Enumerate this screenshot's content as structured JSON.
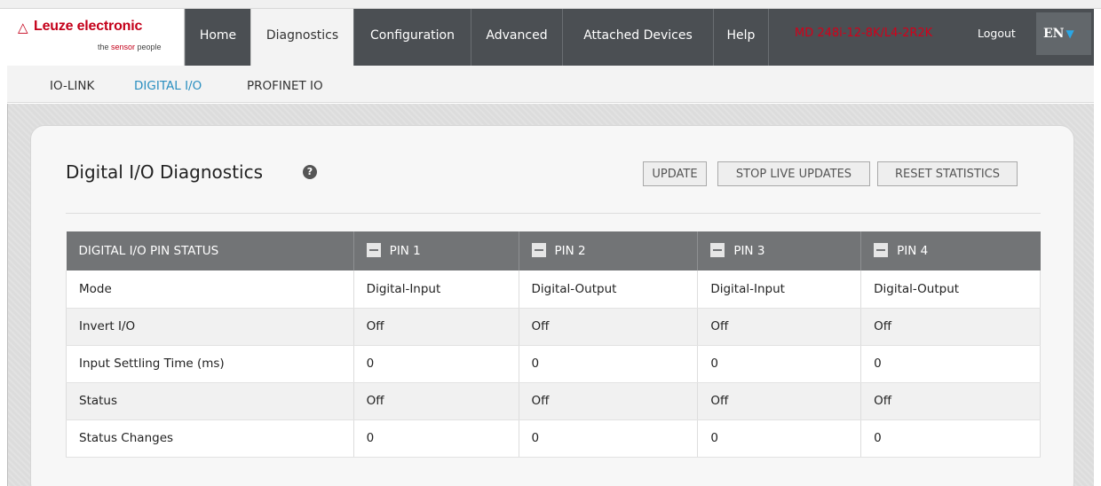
{
  "brand": {
    "name": "Leuze electronic",
    "tagline_prefix": "the ",
    "tagline_accent": "sensor",
    "tagline_suffix": " people"
  },
  "nav": {
    "items": [
      {
        "label": "Home"
      },
      {
        "label": "Diagnostics"
      },
      {
        "label": "Configuration"
      },
      {
        "label": "Advanced"
      },
      {
        "label": "Attached Devices"
      },
      {
        "label": "Help"
      }
    ],
    "device_name": "MD 248i-12-8K/L4-2R2K",
    "logout": "Logout",
    "language": "EN",
    "active_index": 1
  },
  "subnav": {
    "items": [
      {
        "label": "IO-LINK"
      },
      {
        "label": "DIGITAL I/O"
      },
      {
        "label": "PROFINET IO"
      }
    ],
    "active_index": 1
  },
  "page": {
    "title": "Digital I/O Diagnostics",
    "buttons": {
      "update": "UPDATE",
      "stop": "STOP LIVE UPDATES",
      "reset": "RESET STATISTICS"
    }
  },
  "table": {
    "header": "DIGITAL I/O PIN STATUS",
    "pins": [
      "PIN 1",
      "PIN 2",
      "PIN 3",
      "PIN 4"
    ],
    "rows": [
      {
        "label": "Mode",
        "values": [
          "Digital-Input",
          "Digital-Output",
          "Digital-Input",
          "Digital-Output"
        ]
      },
      {
        "label": "Invert I/O",
        "values": [
          "Off",
          "Off",
          "Off",
          "Off"
        ]
      },
      {
        "label": "Input Settling Time (ms)",
        "values": [
          "0",
          "0",
          "0",
          "0"
        ]
      },
      {
        "label": "Status",
        "values": [
          "Off",
          "Off",
          "Off",
          "Off"
        ]
      },
      {
        "label": "Status Changes",
        "values": [
          "0",
          "0",
          "0",
          "0"
        ]
      }
    ]
  },
  "colors": {
    "brand_red": "#c4001a",
    "header_bg": "#4b4f53",
    "active_link": "#2a8fc0",
    "table_header_bg": "#727476"
  }
}
